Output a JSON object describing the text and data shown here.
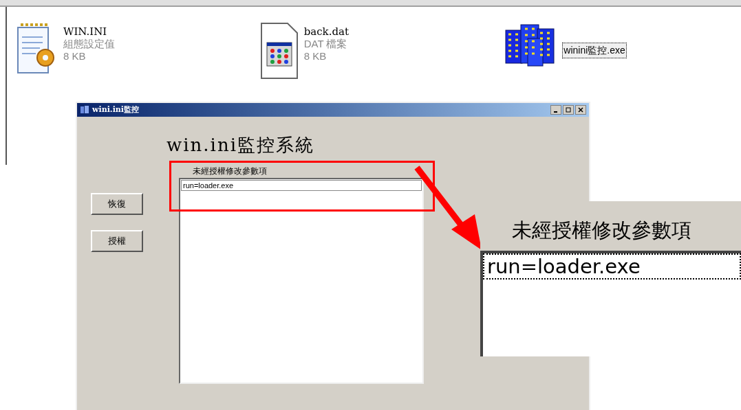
{
  "explorer": {
    "files": [
      {
        "kind": "ini",
        "name": "WIN.INI",
        "type": "組態設定值",
        "size": "8 KB",
        "selected": false
      },
      {
        "kind": "dat",
        "name": "back.dat",
        "type": "DAT 檔案",
        "size": "8 KB",
        "selected": false
      },
      {
        "kind": "exe",
        "name": "winini監控.exe",
        "selected": true
      }
    ]
  },
  "window": {
    "title": "wini.ini監控",
    "heading": "win.ini監控系統",
    "buttons": [
      "恢復",
      "授權"
    ],
    "list": {
      "label": "未經授權修改參數項",
      "items": [
        {
          "text": "run=loader.exe",
          "selected": true
        }
      ]
    }
  },
  "callout": {
    "label": "未經授權修改參數項",
    "items": [
      {
        "text": "run=loader.exe",
        "selected": true
      }
    ]
  }
}
